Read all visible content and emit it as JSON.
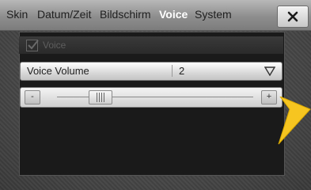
{
  "tabs": [
    {
      "label": "Skin",
      "active": false
    },
    {
      "label": "Datum/Zeit",
      "active": false
    },
    {
      "label": "Bildschirm",
      "active": false
    },
    {
      "label": "Voice",
      "active": true
    },
    {
      "label": "System",
      "active": false
    }
  ],
  "close_icon": "close-icon",
  "voice_toggle": {
    "label": "Voice",
    "checked": true
  },
  "voice_volume": {
    "label": "Voice Volume",
    "value": "2"
  },
  "slider": {
    "minus_label": "-",
    "plus_label": "+",
    "level": 0.28
  },
  "colors": {
    "accent_arrow": "#f7c520",
    "active_tab_text": "#ffffff"
  }
}
